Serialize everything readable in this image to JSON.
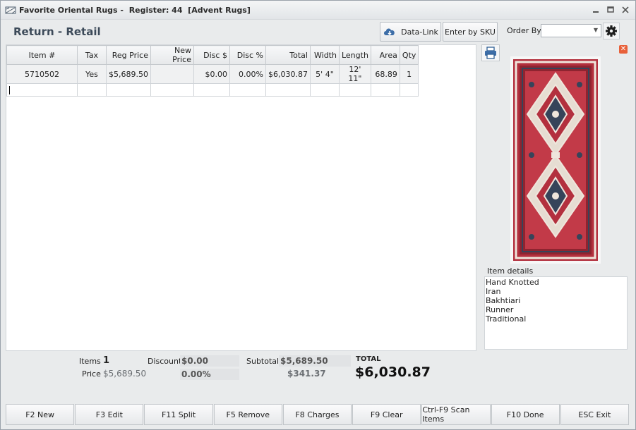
{
  "window": {
    "app_name": "Favorite Oriental Rugs -",
    "register": "Register: 44",
    "store": "[Advent Rugs]"
  },
  "header": {
    "title": "Return - Retail",
    "datalink_label": "Data-Link",
    "enter_sku_label": "Enter by SKU",
    "order_by_label": "Order By",
    "order_by_value": ""
  },
  "grid": {
    "columns": [
      "Item #",
      "Tax",
      "Reg Price",
      "New Price",
      "Disc $",
      "Disc %",
      "Total",
      "Width",
      "Length",
      "Area",
      "Qty"
    ],
    "rows": [
      [
        "5710502",
        "Yes",
        "$5,689.50",
        "",
        "$0.00",
        "0.00%",
        "$6,030.87",
        "5' 4\"",
        "12' 11\"",
        "68.89",
        "1"
      ]
    ]
  },
  "item_details": {
    "label": "Item details",
    "lines": [
      "Hand Knotted",
      "Iran",
      "Bakhtiari",
      "Runner",
      "Traditional"
    ]
  },
  "totals": {
    "items_label": "Items",
    "items_value": "1",
    "price_label": "Price",
    "price_value": "$5,689.50",
    "discount_label": "Discount",
    "discount_amount": "$0.00",
    "discount_percent": "0.00%",
    "subtotal_label": "Subtotal",
    "subtotal_value": "$5,689.50",
    "tax_value": "$341.37",
    "total_label": "TOTAL",
    "total_value": "$6,030.87"
  },
  "function_keys": [
    "F2 New",
    "F3 Edit",
    "F11 Split",
    "F5 Remove",
    "F8 Charges",
    "F9 Clear",
    "Ctrl-F9 Scan Items",
    "F10 Done",
    "ESC Exit"
  ],
  "colors": {
    "header_title": "#3c4a59",
    "close_badge": "#e8603a",
    "rug_red": "#b3303e",
    "rug_cream": "#efe6dc",
    "rug_navy": "#36445a"
  }
}
